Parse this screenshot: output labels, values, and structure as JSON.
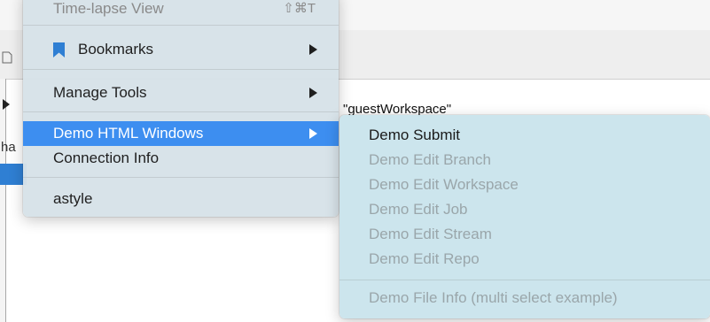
{
  "background": {
    "row_text": "ha",
    "workspace_label": "\"guestWorkspace\""
  },
  "menu": {
    "items": [
      {
        "label": "Time-lapse View",
        "shortcut": "⇧⌘T",
        "state": "faded"
      },
      {
        "label": "Bookmarks",
        "has_submenu": true,
        "icon": "bookmark-icon"
      },
      {
        "label": "Manage Tools",
        "has_submenu": true
      },
      {
        "label": "Demo HTML Windows",
        "has_submenu": true,
        "highlighted": true
      },
      {
        "label": "Connection Info"
      },
      {
        "label": "astyle"
      }
    ]
  },
  "submenu": {
    "items": [
      {
        "label": "Demo Submit",
        "enabled": true
      },
      {
        "label": "Demo Edit Branch",
        "enabled": false
      },
      {
        "label": "Demo Edit Workspace",
        "enabled": false
      },
      {
        "label": "Demo Edit Job",
        "enabled": false
      },
      {
        "label": "Demo Edit Stream",
        "enabled": false
      },
      {
        "label": "Demo Edit Repo",
        "enabled": false
      },
      {
        "label": "Demo File Info (multi select example)",
        "enabled": false
      }
    ]
  },
  "colors": {
    "highlight": "#3d8ef0",
    "bookmark": "#2f7fd3",
    "disabled_text": "#9aa6aa"
  }
}
